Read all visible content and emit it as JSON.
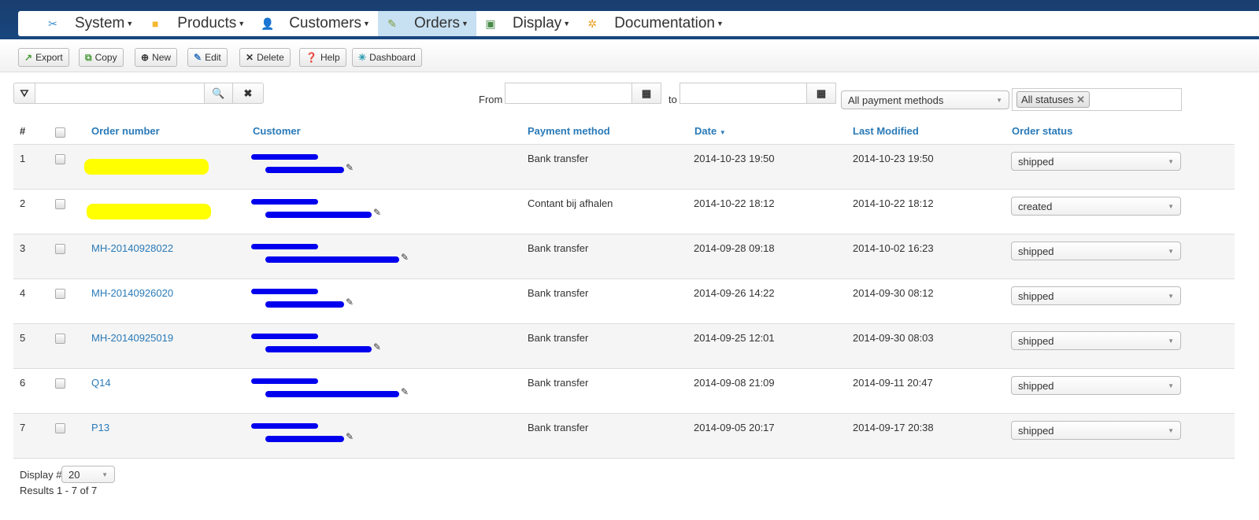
{
  "menu": [
    {
      "label": "System",
      "icon": "tools-icon",
      "glyph": "✂",
      "color": "#3a8fd0"
    },
    {
      "label": "Products",
      "icon": "box-icon",
      "glyph": "■",
      "color": "#f5b82e"
    },
    {
      "label": "Customers",
      "icon": "users-icon",
      "glyph": "👤",
      "color": "#e07b2a"
    },
    {
      "label": "Orders",
      "icon": "orders-icon",
      "glyph": "✎",
      "color": "#7a9a3a",
      "active": true
    },
    {
      "label": "Display",
      "icon": "display-icon",
      "glyph": "▣",
      "color": "#4a8a4a"
    },
    {
      "label": "Documentation",
      "icon": "documentation-icon",
      "glyph": "✲",
      "color": "#e8a020"
    }
  ],
  "toolbar": {
    "export": "Export",
    "copy": "Copy",
    "new": "New",
    "edit": "Edit",
    "delete": "Delete",
    "help": "Help",
    "dashboard": "Dashboard"
  },
  "filters": {
    "search_value": "",
    "from_label": "From",
    "to_label": "to",
    "from_value": "",
    "to_value": "",
    "payment_method": "All payment methods",
    "status_tag": "All statuses"
  },
  "columns": {
    "num": "#",
    "order_number": "Order number",
    "customer": "Customer",
    "payment": "Payment method",
    "date": "Date",
    "modified": "Last Modified",
    "status": "Order status"
  },
  "rows": [
    {
      "n": "1",
      "order": "",
      "payment": "Bank transfer",
      "date": "2014-10-23 19:50",
      "modified": "2014-10-23 19:50",
      "status": "shipped"
    },
    {
      "n": "2",
      "order": "",
      "payment": "Contant bij afhalen",
      "date": "2014-10-22 18:12",
      "modified": "2014-10-22 18:12",
      "status": "created"
    },
    {
      "n": "3",
      "order": "MH-20140928022",
      "payment": "Bank transfer",
      "date": "2014-09-28 09:18",
      "modified": "2014-10-02 16:23",
      "status": "shipped"
    },
    {
      "n": "4",
      "order": "MH-20140926020",
      "payment": "Bank transfer",
      "date": "2014-09-26 14:22",
      "modified": "2014-09-30 08:12",
      "status": "shipped"
    },
    {
      "n": "5",
      "order": "MH-20140925019",
      "payment": "Bank transfer",
      "date": "2014-09-25 12:01",
      "modified": "2014-09-30 08:03",
      "status": "shipped"
    },
    {
      "n": "6",
      "order": "Q14",
      "payment": "Bank transfer",
      "date": "2014-09-08 21:09",
      "modified": "2014-09-11 20:47",
      "status": "shipped"
    },
    {
      "n": "7",
      "order": "P13",
      "payment": "Bank transfer",
      "date": "2014-09-05 20:17",
      "modified": "2014-09-17 20:38",
      "status": "shipped"
    }
  ],
  "footer": {
    "display_label": "Display #",
    "display_value": "20",
    "results": "Results 1 - 7 of 7"
  }
}
